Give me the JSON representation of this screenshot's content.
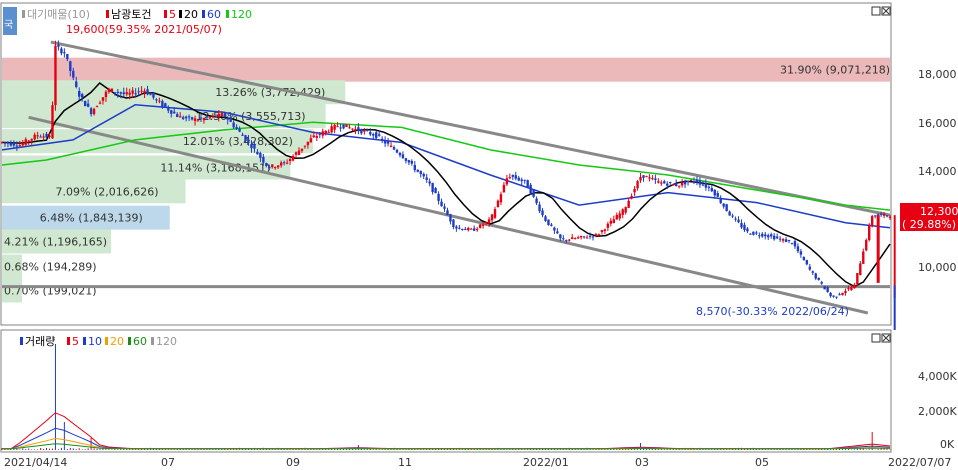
{
  "legend_price": {
    "prefix": "대기매물(10)",
    "stock": "남광토건",
    "ma_labels": [
      "5",
      "20",
      "60",
      "120"
    ],
    "ma_colors": [
      "#e60012",
      "#000000",
      "#1e3cc8",
      "#14c814"
    ]
  },
  "legend_volume": {
    "prefix": "거래량",
    "ma_labels": [
      "5",
      "10",
      "20",
      "60",
      "120"
    ],
    "ma_colors": [
      "#e60012",
      "#1e3cc8",
      "#f0a000",
      "#1a8c1a",
      "#999999"
    ]
  },
  "window_icons": [
    "maximize-icon",
    "close-icon"
  ],
  "corner_label": "국",
  "chart_data": {
    "type": "candlestick",
    "title": "남광토건",
    "period": {
      "start": "2021/04/14",
      "end": "2022/07/07"
    },
    "y_ticks": [
      "18,000",
      "16,000",
      "14,000",
      "12,000",
      "10,000"
    ],
    "volume_ticks": [
      "4,000K",
      "2,000K",
      "0K"
    ],
    "x_ticks": [
      "2021/04/14",
      "07",
      "09",
      "11",
      "2022/01",
      "03",
      "05",
      "2022/07/07"
    ],
    "high_annotation": "19,600(59.35% 2021/05/07)",
    "low_annotation": "8,570(-30.33% 2022/06/24)",
    "current_price": "12,300",
    "current_change": "( 29.88%)",
    "horizontal_line": 9450,
    "volume_profile": [
      {
        "label": "31.90% (9,071,218)",
        "pct": 31.9,
        "price": 18100,
        "color": "#ecb9bb"
      },
      {
        "label": "13.26% (3,772,429)",
        "pct": 13.26,
        "price": 17200,
        "color": "#cfe8cf"
      },
      {
        "label": "12.50% (3,555,713)",
        "pct": 12.5,
        "price": 16250,
        "color": "#cfe8cf"
      },
      {
        "label": "12.01% (3,428,302)",
        "pct": 12.01,
        "price": 15250,
        "color": "#cfe8cf"
      },
      {
        "label": "11.14% (3,168,151)",
        "pct": 11.14,
        "price": 14200,
        "color": "#cfe8cf"
      },
      {
        "label": "7.09% (2,016,626)",
        "pct": 7.09,
        "price": 13250,
        "color": "#cfe8cf"
      },
      {
        "label": "6.48% (1,843,139)",
        "pct": 6.48,
        "price": 12200,
        "color": "#bcd8ea"
      },
      {
        "label": "4.21% (1,196,165)",
        "pct": 4.21,
        "price": 11250,
        "color": "#cfe8cf"
      },
      {
        "label": "0.68% (194,289)",
        "pct": 0.68,
        "price": 10250,
        "color": "#cfe8cf"
      },
      {
        "label": "0.70% (199,021)",
        "pct": 0.7,
        "price": 9300,
        "color": "#cfe8cf"
      }
    ],
    "channel": {
      "upper": [
        {
          "x": "2021/05/07",
          "y": 19200
        },
        {
          "x": "2022/07/07",
          "y": 12300
        }
      ],
      "lower": [
        {
          "x": "2021/04/14",
          "y": 16200
        },
        {
          "x": "2022/07/07",
          "y": 8400
        }
      ]
    },
    "price_path": [
      {
        "t": 0.0,
        "p": 15200
      },
      {
        "t": 0.02,
        "p": 15100
      },
      {
        "t": 0.04,
        "p": 15500
      },
      {
        "t": 0.055,
        "p": 15400
      },
      {
        "t": 0.06,
        "p": 19000
      },
      {
        "t": 0.07,
        "p": 18800
      },
      {
        "t": 0.085,
        "p": 17200
      },
      {
        "t": 0.1,
        "p": 16400
      },
      {
        "t": 0.12,
        "p": 17300
      },
      {
        "t": 0.14,
        "p": 17100
      },
      {
        "t": 0.16,
        "p": 17300
      },
      {
        "t": 0.18,
        "p": 16700
      },
      {
        "t": 0.2,
        "p": 16200
      },
      {
        "t": 0.22,
        "p": 16100
      },
      {
        "t": 0.25,
        "p": 16300
      },
      {
        "t": 0.28,
        "p": 15100
      },
      {
        "t": 0.3,
        "p": 14200
      },
      {
        "t": 0.32,
        "p": 14400
      },
      {
        "t": 0.35,
        "p": 15400
      },
      {
        "t": 0.38,
        "p": 15900
      },
      {
        "t": 0.42,
        "p": 15500
      },
      {
        "t": 0.45,
        "p": 14700
      },
      {
        "t": 0.48,
        "p": 13600
      },
      {
        "t": 0.51,
        "p": 11800
      },
      {
        "t": 0.53,
        "p": 11700
      },
      {
        "t": 0.55,
        "p": 12100
      },
      {
        "t": 0.57,
        "p": 13900
      },
      {
        "t": 0.59,
        "p": 13600
      },
      {
        "t": 0.61,
        "p": 12200
      },
      {
        "t": 0.63,
        "p": 11300
      },
      {
        "t": 0.65,
        "p": 11400
      },
      {
        "t": 0.67,
        "p": 11500
      },
      {
        "t": 0.7,
        "p": 12500
      },
      {
        "t": 0.72,
        "p": 13900
      },
      {
        "t": 0.74,
        "p": 13600
      },
      {
        "t": 0.76,
        "p": 13500
      },
      {
        "t": 0.78,
        "p": 13700
      },
      {
        "t": 0.8,
        "p": 13300
      },
      {
        "t": 0.82,
        "p": 12300
      },
      {
        "t": 0.84,
        "p": 11600
      },
      {
        "t": 0.86,
        "p": 11500
      },
      {
        "t": 0.88,
        "p": 11300
      },
      {
        "t": 0.89,
        "p": 11200
      },
      {
        "t": 0.91,
        "p": 10100
      },
      {
        "t": 0.935,
        "p": 9000
      },
      {
        "t": 0.96,
        "p": 9500
      },
      {
        "t": 0.98,
        "p": 12300
      },
      {
        "t": 1.0,
        "p": 12300
      }
    ],
    "ma120": [
      {
        "t": 0.0,
        "p": 14300
      },
      {
        "t": 0.05,
        "p": 14500
      },
      {
        "t": 0.15,
        "p": 15300
      },
      {
        "t": 0.25,
        "p": 15700
      },
      {
        "t": 0.35,
        "p": 16000
      },
      {
        "t": 0.45,
        "p": 15800
      },
      {
        "t": 0.55,
        "p": 14900
      },
      {
        "t": 0.65,
        "p": 14300
      },
      {
        "t": 0.75,
        "p": 13900
      },
      {
        "t": 0.85,
        "p": 13300
      },
      {
        "t": 0.95,
        "p": 12700
      },
      {
        "t": 1.0,
        "p": 12500
      }
    ],
    "ma60": [
      {
        "t": 0.0,
        "p": 14900
      },
      {
        "t": 0.08,
        "p": 15300
      },
      {
        "t": 0.15,
        "p": 16700
      },
      {
        "t": 0.25,
        "p": 16400
      },
      {
        "t": 0.35,
        "p": 15600
      },
      {
        "t": 0.45,
        "p": 15200
      },
      {
        "t": 0.55,
        "p": 13900
      },
      {
        "t": 0.65,
        "p": 12700
      },
      {
        "t": 0.75,
        "p": 13200
      },
      {
        "t": 0.85,
        "p": 12800
      },
      {
        "t": 0.95,
        "p": 12000
      },
      {
        "t": 1.0,
        "p": 11800
      }
    ],
    "volume_spikes": [
      {
        "t": 0.06,
        "v": 5300
      },
      {
        "t": 0.07,
        "v": 1400
      },
      {
        "t": 0.1,
        "v": 600
      },
      {
        "t": 0.4,
        "v": 250
      },
      {
        "t": 0.72,
        "v": 350
      },
      {
        "t": 0.98,
        "v": 900
      }
    ]
  }
}
